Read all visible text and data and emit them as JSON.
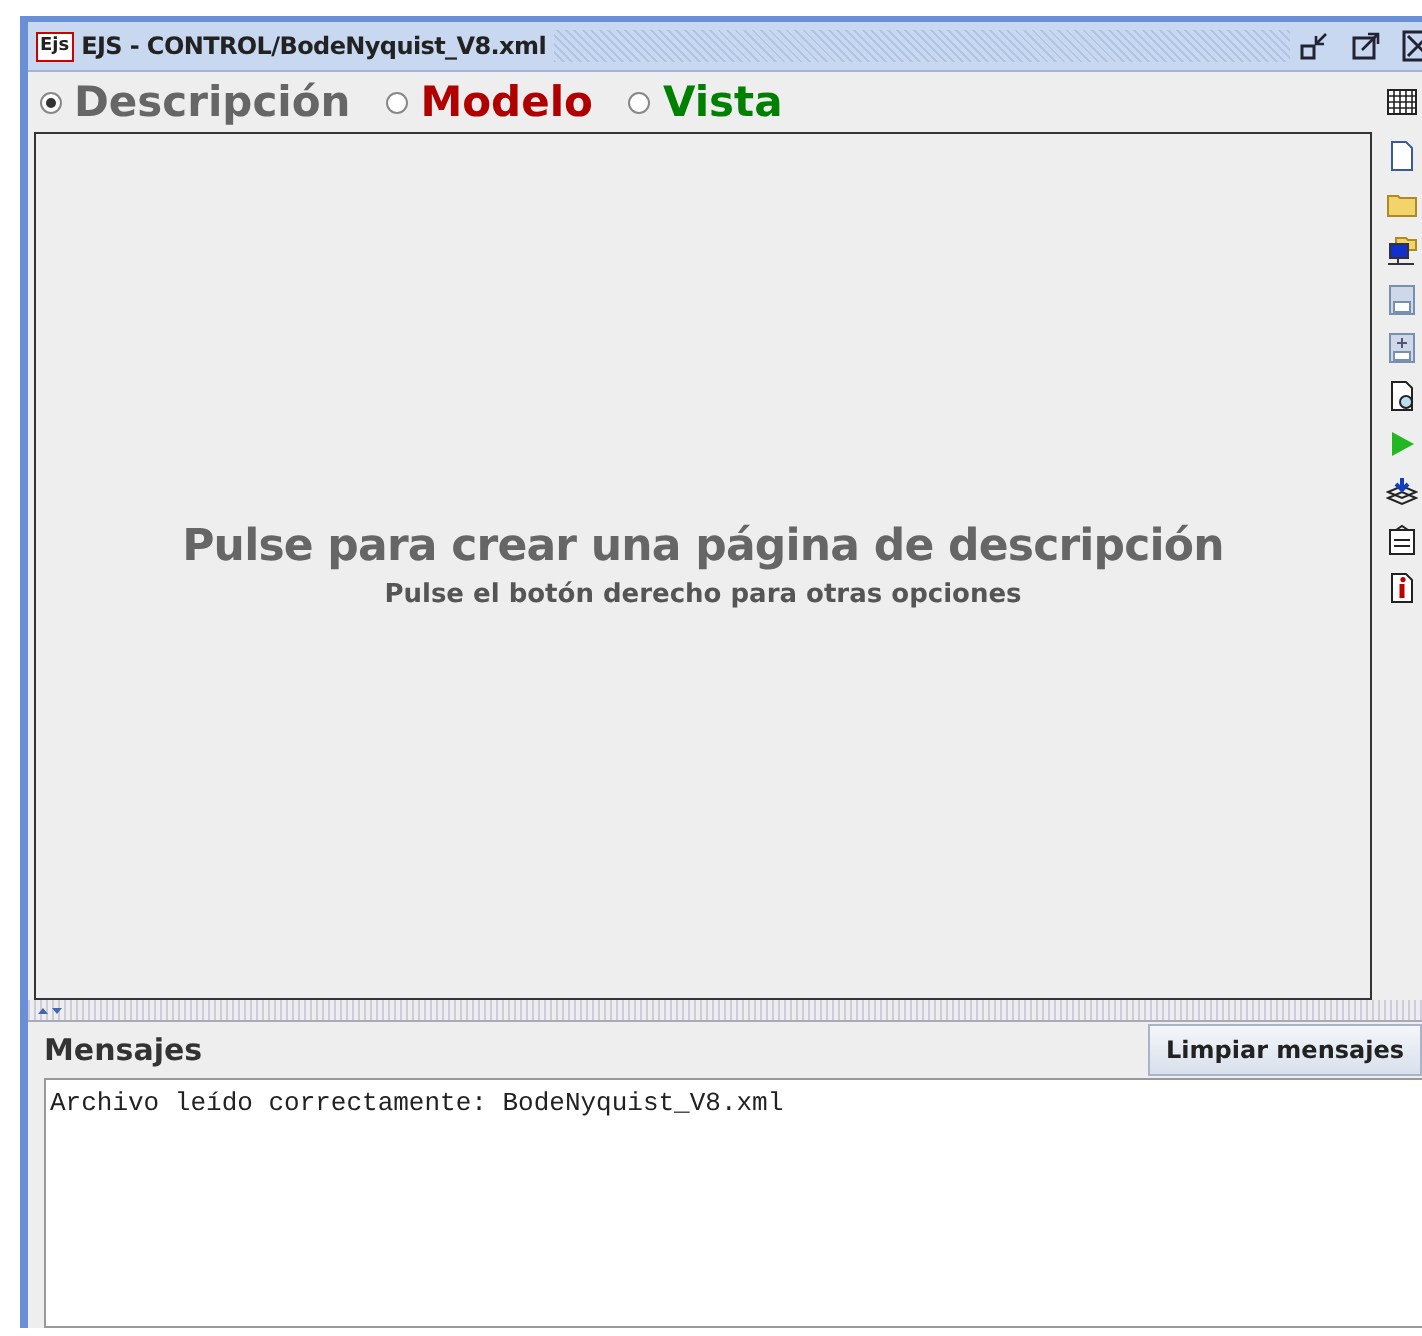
{
  "window": {
    "logo": "Ejs",
    "title": "EJS - CONTROL/BodeNyquist_V8.xml"
  },
  "tabs": [
    {
      "label": "Descripción",
      "selected": true,
      "color": "#666666"
    },
    {
      "label": "Modelo",
      "selected": false,
      "color": "#b00000"
    },
    {
      "label": "Vista",
      "selected": false,
      "color": "#008000"
    }
  ],
  "description": {
    "title": "Pulse para crear una página de descripción",
    "subtitle": "Pulse el botón derecho para otras opciones"
  },
  "messages": {
    "title": "Mensajes",
    "button": "Limpiar mensajes",
    "lines": [
      "Archivo leído correctamente: BodeNyquist_V8.xml"
    ]
  }
}
